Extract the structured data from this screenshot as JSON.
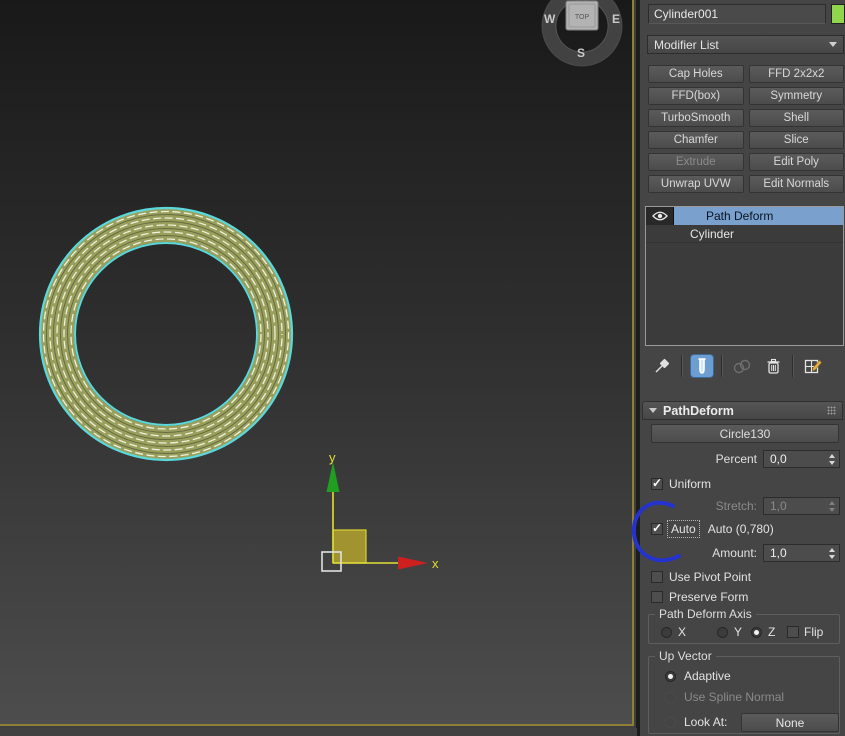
{
  "viewport": {
    "viewcube": {
      "top_label": "TOP",
      "west": "W",
      "east": "E",
      "south": "S"
    },
    "gizmo": {
      "x_label": "x",
      "y_label": "y"
    },
    "colors": {
      "active_border": "#8f7f35",
      "ring_outline": "#5ad8dc",
      "ring_fill": "#99a05e",
      "axis_line": "#e3df34",
      "arrow_y": "#1f9e1f",
      "arrow_x": "#cf2020"
    }
  },
  "annotation": {
    "shape": "hand-drawn-circle",
    "color": "#2433cf"
  },
  "panel": {
    "name_field": {
      "value": "Cylinder001"
    },
    "color_swatch": "#8fd64d",
    "modifier_list": {
      "label": "Modifier List"
    },
    "buttons": [
      {
        "label": "Cap Holes",
        "disabled": false
      },
      {
        "label": "FFD 2x2x2",
        "disabled": false
      },
      {
        "label": "FFD(box)",
        "disabled": false
      },
      {
        "label": "Symmetry",
        "disabled": false
      },
      {
        "label": "TurboSmooth",
        "disabled": false
      },
      {
        "label": "Shell",
        "disabled": false
      },
      {
        "label": "Chamfer",
        "disabled": false
      },
      {
        "label": "Slice",
        "disabled": false
      },
      {
        "label": "Extrude",
        "disabled": true
      },
      {
        "label": "Edit Poly",
        "disabled": false
      },
      {
        "label": "Unwrap UVW",
        "disabled": false
      },
      {
        "label": "Edit Normals",
        "disabled": false
      }
    ],
    "stack": {
      "items": [
        {
          "label": "Path Deform",
          "selected": true,
          "visible": true
        },
        {
          "label": "Cylinder",
          "selected": false
        }
      ]
    },
    "stack_toolbar": {
      "icons": [
        "pin-stack",
        "show-end-result",
        "make-unique",
        "remove-modifier",
        "configure-modifier-sets"
      ],
      "active": "show-end-result",
      "disabled": "make-unique"
    },
    "rollout": {
      "title": "PathDeform",
      "path_object_button": "Circle130",
      "percent": {
        "label": "Percent",
        "value": "0,0"
      },
      "uniform": {
        "label": "Uniform",
        "checked": true
      },
      "stretch": {
        "label": "Stretch:",
        "value": "1,0",
        "disabled": true
      },
      "auto": {
        "label": "Auto",
        "checked": true,
        "value_text": "Auto (0,780)"
      },
      "amount": {
        "label": "Amount:",
        "value": "1,0"
      },
      "use_pivot_point": {
        "label": "Use Pivot Point",
        "checked": false
      },
      "preserve_form": {
        "label": "Preserve Form",
        "checked": false
      },
      "axis_group": {
        "title": "Path Deform Axis",
        "options": [
          {
            "label": "X",
            "selected": false
          },
          {
            "label": "Y",
            "selected": false
          },
          {
            "label": "Z",
            "selected": true
          }
        ],
        "flip": {
          "label": "Flip",
          "checked": false
        }
      },
      "up_vector": {
        "title": "Up Vector",
        "adaptive": {
          "label": "Adaptive",
          "selected": true
        },
        "use_spline_normal": {
          "label": "Use Spline Normal",
          "disabled": true
        },
        "look_at": {
          "label": "Look At:",
          "disabled": true
        },
        "none_button": "None"
      }
    }
  }
}
